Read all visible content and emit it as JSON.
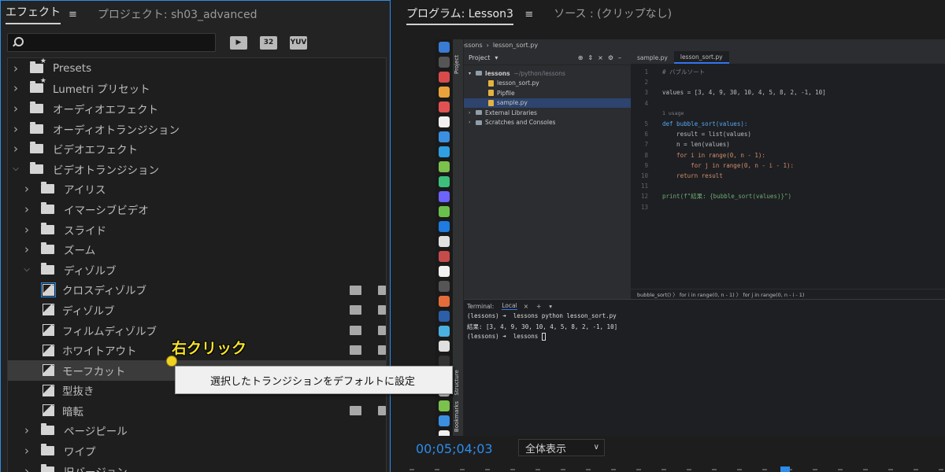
{
  "effects_panel": {
    "tab_effects": "エフェクト",
    "tab_project": "プロジェクト: sh03_advanced",
    "menu_glyph": "≡",
    "search_placeholder": "",
    "filter_buttons": [
      "32",
      "YUV"
    ],
    "tree": [
      {
        "label": "Presets",
        "level": 0,
        "expanded": false,
        "type": "star-folder"
      },
      {
        "label": "Lumetri プリセット",
        "level": 0,
        "expanded": false,
        "type": "star-folder"
      },
      {
        "label": "オーディオエフェクト",
        "level": 0,
        "expanded": false,
        "type": "folder"
      },
      {
        "label": "オーディオトランジション",
        "level": 0,
        "expanded": false,
        "type": "folder"
      },
      {
        "label": "ビデオエフェクト",
        "level": 0,
        "expanded": false,
        "type": "folder"
      },
      {
        "label": "ビデオトランジション",
        "level": 0,
        "expanded": true,
        "type": "folder"
      },
      {
        "label": "アイリス",
        "level": 1,
        "expanded": false,
        "type": "folder"
      },
      {
        "label": "イマーシブビデオ",
        "level": 1,
        "expanded": false,
        "type": "folder"
      },
      {
        "label": "スライド",
        "level": 1,
        "expanded": false,
        "type": "folder"
      },
      {
        "label": "ズーム",
        "level": 1,
        "expanded": false,
        "type": "folder"
      },
      {
        "label": "ディゾルブ",
        "level": 1,
        "expanded": true,
        "type": "folder"
      },
      {
        "label": "クロスディゾルブ",
        "level": 2,
        "type": "transition",
        "badges": true,
        "default": true
      },
      {
        "label": "ディゾルブ",
        "level": 2,
        "type": "transition",
        "badges": true
      },
      {
        "label": "フィルムディゾルブ",
        "level": 2,
        "type": "transition",
        "badges": true
      },
      {
        "label": "ホワイトアウト",
        "level": 2,
        "type": "transition",
        "badges": true
      },
      {
        "label": "モーフカット",
        "level": 2,
        "type": "transition",
        "badges": false,
        "highlighted": true
      },
      {
        "label": "型抜き",
        "level": 2,
        "type": "transition",
        "badges": false
      },
      {
        "label": "暗転",
        "level": 2,
        "type": "transition",
        "badges": true
      },
      {
        "label": "ページピール",
        "level": 1,
        "expanded": false,
        "type": "folder"
      },
      {
        "label": "ワイプ",
        "level": 1,
        "expanded": false,
        "type": "folder"
      },
      {
        "label": "旧バージョン",
        "level": 1,
        "expanded": false,
        "type": "folder"
      }
    ]
  },
  "program_panel": {
    "tab_program": "プログラム: Lesson3",
    "menu_glyph": "≡",
    "tab_source": "ソース : (クリップなし)",
    "timecode": "00;05;04;03",
    "zoom_label": "全体表示"
  },
  "ide": {
    "top_tab_project": "lessons",
    "top_tab_file": "lesson_sort.py",
    "project_label": "Project",
    "project_tree": [
      {
        "label": "lessons",
        "hint": "~/python/lessons",
        "level": 0,
        "kind": "dir"
      },
      {
        "label": "lesson_sort.py",
        "level": 1,
        "kind": "file"
      },
      {
        "label": "Pipfile",
        "level": 1,
        "kind": "file"
      },
      {
        "label": "sample.py",
        "level": 1,
        "kind": "file",
        "selected": true
      },
      {
        "label": "External Libraries",
        "level": 0,
        "kind": "dir"
      },
      {
        "label": "Scratches and Consoles",
        "level": 0,
        "kind": "dir"
      }
    ],
    "editor_tabs": [
      "sample.py",
      "lesson_sort.py"
    ],
    "active_editor_tab": 1,
    "code_lines": [
      {
        "n": "1",
        "text": "# バブルソート",
        "cls": "cm"
      },
      {
        "n": "2",
        "text": ""
      },
      {
        "n": "3",
        "text": "values = [3, 4, 9, 30, 10, 4, 5, 8, 2, -1, 10]",
        "cls": "txt"
      },
      {
        "n": "4",
        "text": ""
      },
      {
        "n": "",
        "text": "1 usage",
        "cls": "hint"
      },
      {
        "n": "5",
        "text": "def bubble_sort(values):",
        "cls": "fn"
      },
      {
        "n": "6",
        "text": "    result = list(values)",
        "cls": "txt"
      },
      {
        "n": "7",
        "text": "    n = len(values)",
        "cls": "txt"
      },
      {
        "n": "8",
        "text": "    for i in range(0, n - 1):",
        "cls": "kw"
      },
      {
        "n": "9",
        "text": "        for j in range(0, n - i - 1):",
        "cls": "kw"
      },
      {
        "n": "10",
        "text": "    return result",
        "cls": "kw"
      },
      {
        "n": "11",
        "text": ""
      },
      {
        "n": "12",
        "text": "print(f\"結果: {bubble_sort(values)}\")",
        "cls": "str"
      },
      {
        "n": "13",
        "text": ""
      }
    ],
    "breadcrumb": "bubble_sort()  〉  for i in range(0, n - 1)  〉  for j in range(0, n - i - 1)",
    "terminal_label": "Terminal:",
    "terminal_tab": "Local",
    "terminal_lines": [
      "(lessons) ➜  lessons python lesson_sort.py",
      "結果: [3, 4, 9, 30, 10, 4, 5, 8, 2, -1, 10]",
      "(lessons) ➜  lessons "
    ],
    "side_labels": [
      "Project",
      "Structure",
      "Bookmarks"
    ]
  },
  "context_menu": {
    "item": "選択したトランジションをデフォルトに設定"
  },
  "annotation": {
    "text": "右クリック"
  },
  "colors": {
    "accent": "#2d8ceb",
    "annotation": "#f6e22a"
  }
}
